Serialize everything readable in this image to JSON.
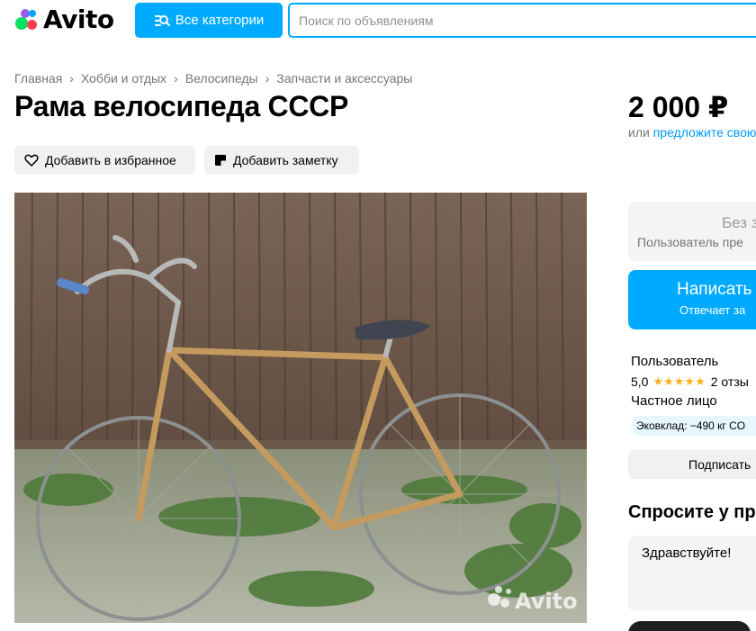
{
  "header": {
    "logo_text": "Avito",
    "categories_label": "Все категории",
    "search_placeholder": "Поиск по объявлениям"
  },
  "breadcrumbs": [
    "Главная",
    "Хобби и отдых",
    "Велосипеды",
    "Запчасти и аксессуары"
  ],
  "listing": {
    "title": "Рама велосипеда СССР",
    "favorite_label": "Добавить в избранное",
    "note_label": "Добавить заметку",
    "photo_watermark": "Avito"
  },
  "sidebar": {
    "price": "2 000 ₽",
    "price_or": "или",
    "price_offer_link": "предложите свою",
    "delivery_title": "Без з",
    "delivery_subtitle": "Пользователь пре",
    "write_title": "Написать",
    "write_subtitle": "Отвечает за",
    "seller_name": "Пользователь",
    "rating_value": "5,0",
    "rating_stars": 5,
    "reviews": "2 отзы",
    "seller_type": "Частное лицо",
    "eco_label": "Эковклад: −490 кг CO",
    "subscribe_label": "Подписать",
    "ask_title": "Спросите у пр",
    "message_value": "Здравствуйте!"
  },
  "colors": {
    "accent": "#00aaff",
    "link": "#0099f7",
    "star": "#ffb021",
    "pill_bg": "#f2f1f0"
  }
}
